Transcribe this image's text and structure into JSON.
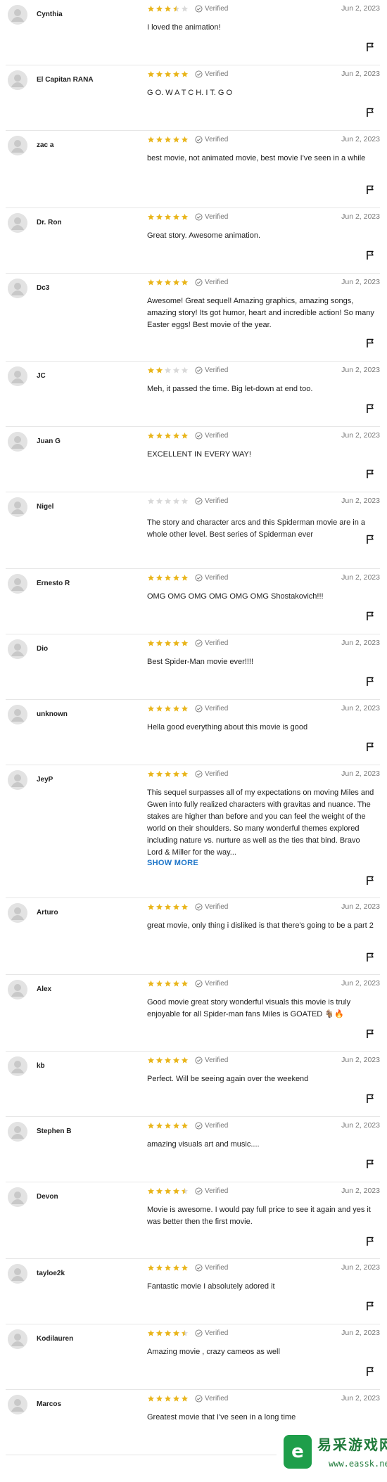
{
  "colors": {
    "star_filled": "#e9b51b",
    "star_empty": "#d9d9d9",
    "show_more": "#1a73c8",
    "verified": "#777777"
  },
  "labels": {
    "verified": "Verified",
    "show_more": "SHOW MORE"
  },
  "icons": {
    "avatar": "user-avatar-icon",
    "verified": "check-circle-icon",
    "report": "flag-icon"
  },
  "reviews": [
    {
      "user": "Cynthia",
      "rating": 3.5,
      "date": "Jun 2, 2023",
      "text": "I loved the animation!"
    },
    {
      "user": "El Capitan RANA",
      "rating": 5,
      "date": "Jun 2, 2023",
      "text": "G O. W A T C H. I T. G O"
    },
    {
      "user": "zac a",
      "rating": 5,
      "date": "Jun 2, 2023",
      "text": "best movie, not animated movie, best movie I've seen in a while"
    },
    {
      "user": "Dr. Ron",
      "rating": 5,
      "date": "Jun 2, 2023",
      "text": "Great story. Awesome animation."
    },
    {
      "user": "Dc3",
      "rating": 5,
      "date": "Jun 2, 2023",
      "text": "Awesome! Great sequel! Amazing graphics, amazing songs, amazing story! Its got humor, heart and incredible action! So many Easter eggs! Best movie of the year."
    },
    {
      "user": "JC",
      "rating": 2,
      "date": "Jun 2, 2023",
      "text": "Meh, it passed the time. Big let-down at end too."
    },
    {
      "user": "Juan G",
      "rating": 5,
      "date": "Jun 2, 2023",
      "text": "EXCELLENT IN EVERY WAY!"
    },
    {
      "user": "Nigel",
      "rating": 0,
      "date": "Jun 2, 2023",
      "text": "The story and character arcs and this Spiderman movie are in a whole other level. Best series of Spiderman ever"
    },
    {
      "user": "Ernesto R",
      "rating": 5,
      "date": "Jun 2, 2023",
      "text": "OMG OMG OMG OMG OMG OMG Shostakovich!!!"
    },
    {
      "user": "Dio",
      "rating": 5,
      "date": "Jun 2, 2023",
      "text": "Best Spider-Man movie ever!!!!"
    },
    {
      "user": "unknown",
      "rating": 5,
      "date": "Jun 2, 2023",
      "text": "Hella good everything about this movie is good"
    },
    {
      "user": "JeyP",
      "rating": 5,
      "date": "Jun 2, 2023",
      "text": "This sequel surpasses all of my expectations on moving Miles and Gwen into fully realized characters with gravitas and nuance. The stakes are higher than before and you can feel the weight of the world on their shoulders. So many wonderful themes explored including nature vs. nurture as well as the ties that bind. Bravo Lord & Miller for the way...",
      "show_more": true
    },
    {
      "user": "Arturo",
      "rating": 5,
      "date": "Jun 2, 2023",
      "text": "great movie, only thing i disliked is that there's going to be a part 2"
    },
    {
      "user": "Alex",
      "rating": 5,
      "date": "Jun 2, 2023",
      "text": "Good movie great story wonderful visuals this movie is truly enjoyable for all Spider-man fans Miles is GOATED 🐐🔥"
    },
    {
      "user": "kb",
      "rating": 5,
      "date": "Jun 2, 2023",
      "text": "Perfect. Will be seeing again over the weekend"
    },
    {
      "user": "Stephen B",
      "rating": 5,
      "date": "Jun 2, 2023",
      "text": "amazing visuals art and music...."
    },
    {
      "user": "Devon",
      "rating": 4.5,
      "date": "Jun 2, 2023",
      "text": "Movie is awesome. I would pay full price to see it again and yes it was better then the first movie."
    },
    {
      "user": "tayloe2k",
      "rating": 5,
      "date": "Jun 2, 2023",
      "text": "Fantastic movie I absolutely adored it"
    },
    {
      "user": "Kodilauren",
      "rating": 4.5,
      "date": "Jun 2, 2023",
      "text": "Amazing movie , crazy cameos as well"
    },
    {
      "user": "Marcos",
      "rating": 5,
      "date": "Jun 2, 2023",
      "text": "Greatest movie that I've seen in a long time"
    }
  ],
  "watermark": {
    "title": "易采游戏网",
    "url": "www.eassk.net",
    "logo": "e"
  }
}
